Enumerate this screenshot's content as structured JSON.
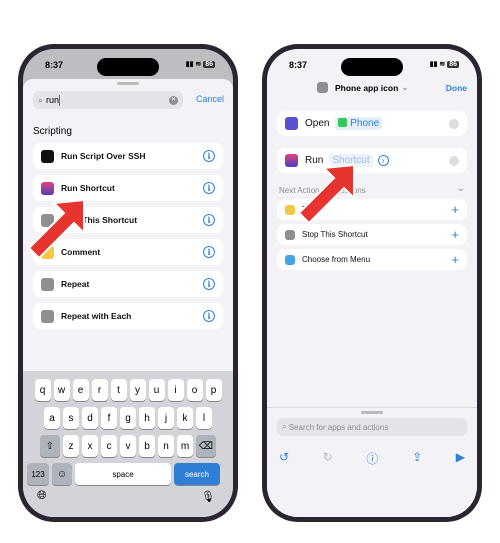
{
  "left": {
    "time": "8:37",
    "battery": "86",
    "search": {
      "value": "run",
      "cancel": "Cancel"
    },
    "section": "Scripting",
    "items": [
      {
        "label": "Run Script Over SSH",
        "color": "#111111"
      },
      {
        "label": "Run Shortcut",
        "color": "#4b3fbf"
      },
      {
        "label": "Stop This Shortcut",
        "color": "#8e8e93"
      },
      {
        "label": "Comment",
        "color": "#f3c844"
      },
      {
        "label": "Repeat",
        "color": "#8e8e93"
      },
      {
        "label": "Repeat with Each",
        "color": "#8e8e93"
      }
    ],
    "keyboard": {
      "row1": [
        "q",
        "w",
        "e",
        "r",
        "t",
        "y",
        "u",
        "i",
        "o",
        "p"
      ],
      "row2": [
        "a",
        "s",
        "d",
        "f",
        "g",
        "h",
        "j",
        "k",
        "l"
      ],
      "row3": [
        "z",
        "x",
        "c",
        "v",
        "b",
        "n",
        "m"
      ],
      "numbers": "123",
      "space": "space",
      "search": "search"
    }
  },
  "right": {
    "time": "8:37",
    "battery": "86",
    "title": "Phone app icon",
    "done": "Done",
    "open_action": {
      "verb": "Open",
      "param": "Phone"
    },
    "run_action": {
      "verb": "Run",
      "param": "Shortcut"
    },
    "suggestions_header": "Next Action Suggestions",
    "suggestions": [
      {
        "label": "Text"
      },
      {
        "label": "Stop This Shortcut"
      },
      {
        "label": "Choose from Menu"
      }
    ],
    "search_placeholder": "Search for apps and actions"
  },
  "accent": "#2f7fd6",
  "arrow_color": "#e8342f"
}
